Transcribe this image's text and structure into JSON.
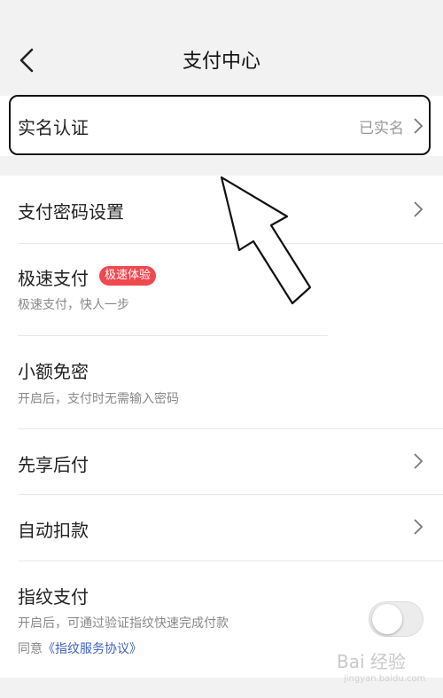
{
  "header": {
    "title": "支付中心"
  },
  "rows": {
    "real_name": {
      "title": "实名认证",
      "value": "已实名"
    },
    "pay_password": {
      "title": "支付密码设置"
    },
    "fast_pay": {
      "title": "极速支付",
      "badge": "极速体验",
      "subtitle": "极速支付，快人一步"
    },
    "small_free": {
      "title": "小额免密",
      "subtitle": "开启后，支付时无需输入密码"
    },
    "pay_later": {
      "title": "先享后付"
    },
    "auto_deduct": {
      "title": "自动扣款"
    },
    "fingerprint": {
      "title": "指纹支付",
      "subtitle": "开启后，可通过验证指纹快速完成付款",
      "agree_prefix": "同意",
      "agree_link": "《指纹服务协议》",
      "toggle_on": false
    }
  },
  "watermark": {
    "text": "Bai 经验",
    "sub": "jingyan.baidu.com"
  },
  "colors": {
    "badge": "#f0484f",
    "link": "#3b5fbf"
  }
}
